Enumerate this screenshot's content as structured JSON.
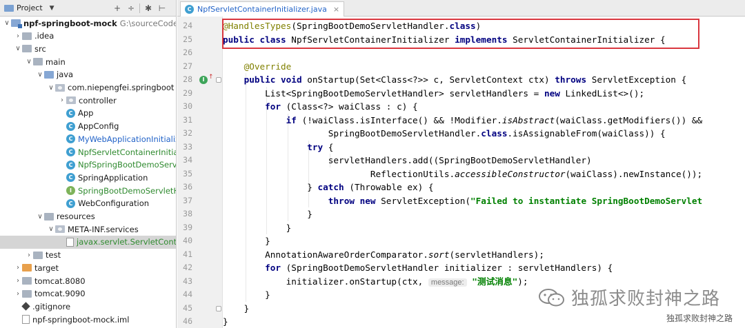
{
  "project_panel": {
    "title": "Project",
    "tools": [
      "+",
      "÷",
      "✱",
      "⊢"
    ],
    "tree": [
      {
        "label": "npf-springboot-mock",
        "path": "G:\\sourceCode\\npf-spr",
        "icon": "module-icon",
        "arrow": "∨",
        "indent": 0,
        "style": "bold"
      },
      {
        "label": ".idea",
        "icon": "folder-icon",
        "arrow": "›",
        "indent": 1
      },
      {
        "label": "src",
        "icon": "folder-icon",
        "arrow": "∨",
        "indent": 1
      },
      {
        "label": "main",
        "icon": "folder-icon",
        "arrow": "∨",
        "indent": 2
      },
      {
        "label": "java",
        "icon": "source-folder-icon",
        "arrow": "∨",
        "indent": 3
      },
      {
        "label": "com.niepengfei.springboot",
        "icon": "package-icon",
        "arrow": "∨",
        "indent": 4
      },
      {
        "label": "controller",
        "icon": "package-icon",
        "arrow": "›",
        "indent": 5
      },
      {
        "label": "App",
        "icon": "class-icon",
        "arrow": "",
        "indent": 5
      },
      {
        "label": "AppConfig",
        "icon": "class-icon",
        "arrow": "",
        "indent": 5
      },
      {
        "label": "MyWebApplicationInitializer",
        "icon": "class-icon",
        "arrow": "",
        "indent": 5,
        "style": "blue"
      },
      {
        "label": "NpfServletContainerInitialize",
        "icon": "class-icon",
        "arrow": "",
        "indent": 5,
        "style": "green"
      },
      {
        "label": "NpfSpringBootDemoServletH",
        "icon": "class-icon",
        "arrow": "",
        "indent": 5,
        "style": "green"
      },
      {
        "label": "SpringApplication",
        "icon": "class-icon",
        "arrow": "",
        "indent": 5
      },
      {
        "label": "SpringBootDemoServletHand",
        "icon": "interface-icon",
        "arrow": "",
        "indent": 5,
        "style": "green"
      },
      {
        "label": "WebConfiguration",
        "icon": "class-icon",
        "arrow": "",
        "indent": 5
      },
      {
        "label": "resources",
        "icon": "folder-icon",
        "arrow": "∨",
        "indent": 3
      },
      {
        "label": "META-INF.services",
        "icon": "package-icon",
        "arrow": "∨",
        "indent": 4
      },
      {
        "label": "javax.servlet.ServletContain",
        "icon": "file-icon",
        "arrow": "",
        "indent": 5,
        "style": "green",
        "selected": true
      },
      {
        "label": "test",
        "icon": "folder-icon",
        "arrow": "›",
        "indent": 2
      },
      {
        "label": "target",
        "icon": "excluded-folder-icon",
        "arrow": "›",
        "indent": 1
      },
      {
        "label": "tomcat.8080",
        "icon": "folder-icon",
        "arrow": "›",
        "indent": 1
      },
      {
        "label": "tomcat.9090",
        "icon": "folder-icon",
        "arrow": "›",
        "indent": 1
      },
      {
        "label": ".gitignore",
        "icon": "git-icon",
        "arrow": "",
        "indent": 1
      },
      {
        "label": "npf-springboot-mock.iml",
        "icon": "iml-file-icon",
        "arrow": "",
        "indent": 1
      }
    ]
  },
  "editor": {
    "tab_label": "NpfServletContainerInitializer.java",
    "lines": [
      {
        "n": "24",
        "html": "<span class=\"an\">@HandlesTypes</span>(SpringBootDemoServletHandler.<span class=\"kw\">class</span>)"
      },
      {
        "n": "25",
        "html": "<span class=\"kw\">public class</span> NpfServletContainerInitializer <span class=\"kw\">implements</span> ServletContainerInitializer {"
      },
      {
        "n": "26",
        "html": ""
      },
      {
        "n": "27",
        "html": "    <span class=\"an\">@Override</span>"
      },
      {
        "n": "28",
        "html": "    <span class=\"kw\">public void</span> onStartup(Set&lt;Class&lt;?&gt;&gt; c, ServletContext ctx) <span class=\"kw\">throws</span> ServletException {"
      },
      {
        "n": "29",
        "html": "        List&lt;SpringBootDemoServletHandler&gt; servletHandlers = <span class=\"kw\">new</span> LinkedList&lt;&gt;();"
      },
      {
        "n": "30",
        "html": "        <span class=\"kw\">for</span> (Class&lt;?&gt; waiClass : c) {"
      },
      {
        "n": "31",
        "html": "            <span class=\"kw\">if</span> (!waiClass.isInterface() &amp;&amp; !Modifier.<span class=\"it\">isAbstract</span>(waiClass.getModifiers()) &amp;&amp;"
      },
      {
        "n": "32",
        "html": "                    SpringBootDemoServletHandler.<span class=\"kw\">class</span>.isAssignableFrom(waiClass)) {"
      },
      {
        "n": "33",
        "html": "                <span class=\"kw\">try</span> {"
      },
      {
        "n": "34",
        "html": "                    servletHandlers.add((SpringBootDemoServletHandler)"
      },
      {
        "n": "35",
        "html": "                            ReflectionUtils.<span class=\"it\">accessibleConstructor</span>(waiClass).newInstance());"
      },
      {
        "n": "36",
        "html": "                } <span class=\"kw\">catch</span> (Throwable ex) {"
      },
      {
        "n": "37",
        "html": "                    <span class=\"kw\">throw new</span> ServletException(<span class=\"st\">\"Failed to instantiate SpringBootDemoServlet</span>"
      },
      {
        "n": "38",
        "html": "                }"
      },
      {
        "n": "39",
        "html": "            }"
      },
      {
        "n": "40",
        "html": "        }"
      },
      {
        "n": "41",
        "html": "        AnnotationAwareOrderComparator.<span class=\"it\">sort</span>(servletHandlers);"
      },
      {
        "n": "42",
        "html": "        <span class=\"kw\">for</span> (SpringBootDemoServletHandler initializer : servletHandlers) {"
      },
      {
        "n": "43",
        "html": "            initializer.onStartup(ctx, <span class=\"hint\">message:</span> <span class=\"st\">\"测试消息\"</span>);"
      },
      {
        "n": "44",
        "html": "        }"
      },
      {
        "n": "45",
        "html": "    }"
      },
      {
        "n": "46",
        "html": "}"
      }
    ]
  },
  "watermark": {
    "large_text": "独孤求败封神之路",
    "small_text": "独孤求败封神之路"
  }
}
